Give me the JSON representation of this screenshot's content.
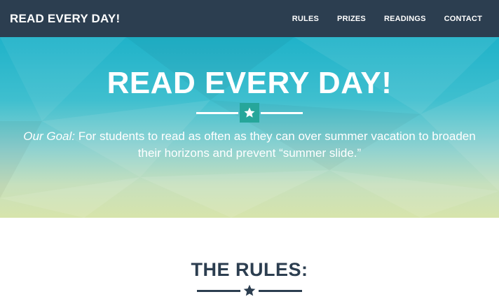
{
  "navbar": {
    "brand": "READ EVERY DAY!",
    "links": [
      {
        "label": "RULES"
      },
      {
        "label": "PRIZES"
      },
      {
        "label": "READINGS"
      },
      {
        "label": "CONTACT"
      }
    ]
  },
  "hero": {
    "title": "READ EVERY DAY!",
    "goal_label": "Our Goal:",
    "goal_text": " For students to read as often as they can over summer vacation to broaden their horizons and prevent “summer slide.”",
    "star_icon": "star-icon"
  },
  "rules": {
    "title": "THE RULES:",
    "star_icon": "star-icon"
  },
  "colors": {
    "navbar_bg": "#2c3e50",
    "accent_teal": "#26a69a",
    "hero_top": "#1fb2c9",
    "hero_bottom": "#d7e4ab",
    "heading_dark": "#2c3e50"
  }
}
